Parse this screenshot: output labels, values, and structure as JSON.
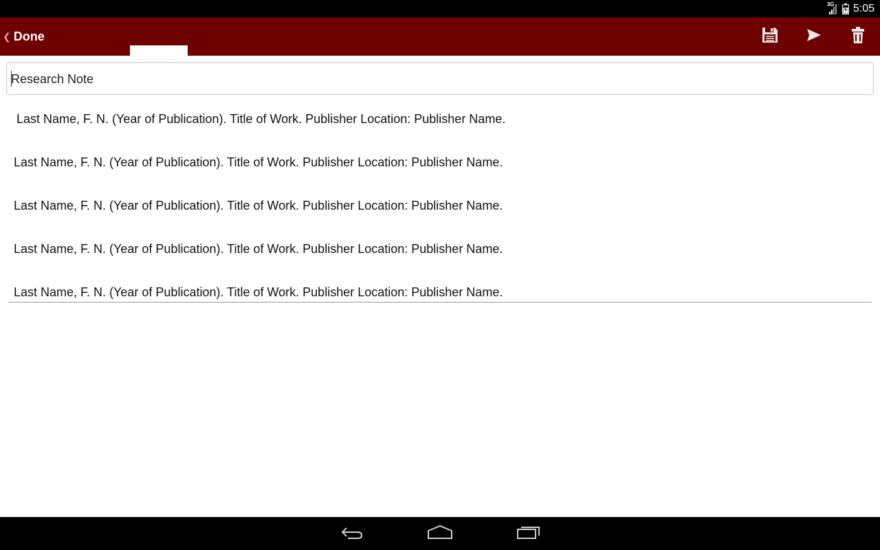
{
  "status_bar": {
    "network": "3G",
    "time": "5:05"
  },
  "action_bar": {
    "back_label": "Done",
    "icons": [
      "save-icon",
      "send-icon",
      "delete-icon"
    ]
  },
  "note": {
    "title": "Research Note",
    "citations": [
      "Last Name, F. N. (Year of Publication). Title of Work. Publisher Location: Publisher Name.",
      "Last Name, F. N. (Year of Publication). Title of Work. Publisher Location: Publisher Name.",
      "Last Name, F. N. (Year of Publication). Title of Work. Publisher Location: Publisher Name.",
      "Last Name, F. N. (Year of Publication). Title of Work. Publisher Location: Publisher Name.",
      "Last Name, F. N. (Year of Publication). Title of Work. Publisher Location: Publisher Name."
    ]
  },
  "navigation": {
    "icons": [
      "back-icon",
      "home-icon",
      "recent-apps-icon"
    ]
  },
  "colors": {
    "action_bar": "#6e0000",
    "status_bar": "#000000",
    "nav_bar": "#000000",
    "icon": "#e8e8e8"
  }
}
